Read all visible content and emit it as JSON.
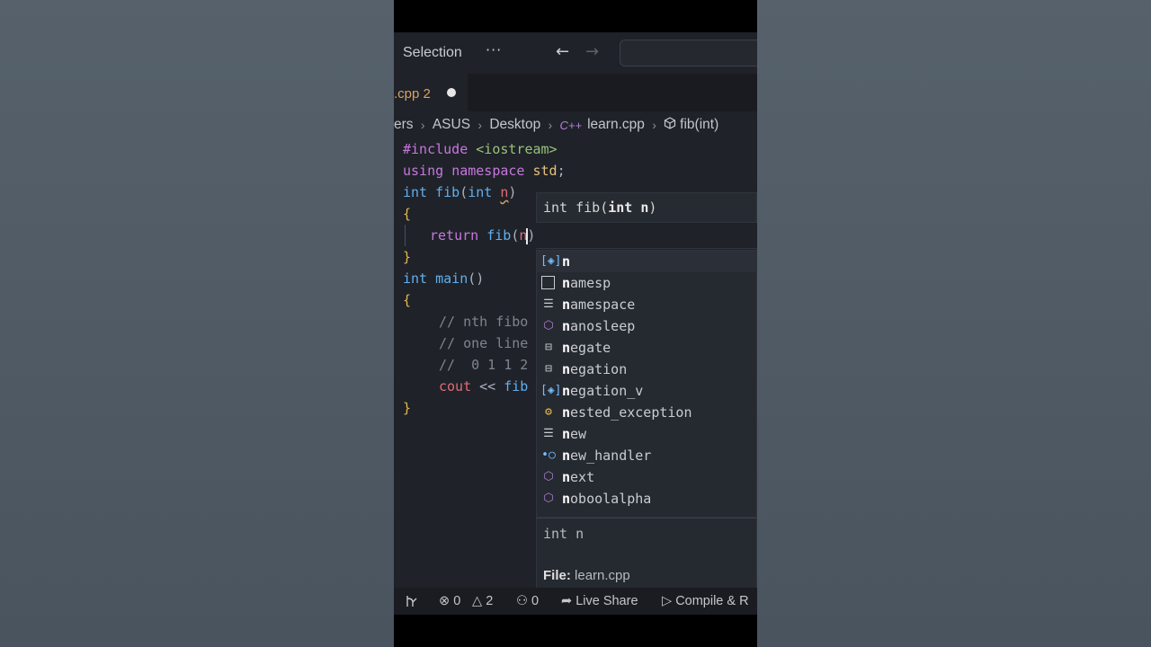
{
  "titlebar": {
    "menu_selection": "Selection",
    "menu_more": "···",
    "nav_back": "←",
    "nav_forward": "→"
  },
  "tab": {
    "label": ".cpp 2",
    "modified_dot": "●"
  },
  "breadcrumb": {
    "items": [
      "ers",
      "ASUS",
      "Desktop",
      "learn.cpp",
      "fib(int)"
    ],
    "separator": "›",
    "cpp_icon": "C++",
    "function_icon": "cube-icon"
  },
  "code": {
    "line1_directive": "#include",
    "line1_header": "<iostream>",
    "line2_kw1": "using",
    "line2_kw2": "namespace",
    "line2_ns": "std",
    "line2_semi": ";",
    "line3_type": "int",
    "line3_fn": "fib",
    "line3_open": "(",
    "line3_ptype": "int",
    "line3_param": "n",
    "line3_close": ")",
    "line4": "{",
    "line5_kw": "return",
    "line5_fn": "fib",
    "line5_open": "(",
    "line5_arg": "n",
    "line5_close": ")",
    "line6": "}",
    "line7_type": "int",
    "line7_fn": "main",
    "line7_parens": "()",
    "line8": "{",
    "line9": "// nth fibo",
    "line10": "// one line",
    "line11": "//  0 1 1 2",
    "line12_cout": "cout",
    "line12_op": "<<",
    "line12_fn": "fib",
    "line13": "}"
  },
  "signature_hint": {
    "type": "int",
    "name": "fib",
    "open": "(",
    "param": "int n",
    "close": ")"
  },
  "suggestions": [
    {
      "icon": "variable-icon",
      "match": "n",
      "rest": ""
    },
    {
      "icon": "namespace-icon",
      "match": "n",
      "rest": "amesp"
    },
    {
      "icon": "keyword-icon",
      "match": "n",
      "rest": "amespace"
    },
    {
      "icon": "method-icon",
      "match": "n",
      "rest": "anosleep"
    },
    {
      "icon": "struct-icon",
      "match": "n",
      "rest": "egate"
    },
    {
      "icon": "struct-icon",
      "match": "n",
      "rest": "egation"
    },
    {
      "icon": "variable-icon",
      "match": "n",
      "rest": "egation_v"
    },
    {
      "icon": "class-icon",
      "match": "n",
      "rest": "ested_exception"
    },
    {
      "icon": "keyword-icon",
      "match": "n",
      "rest": "ew"
    },
    {
      "icon": "interface-icon",
      "match": "n",
      "rest": "ew_handler"
    },
    {
      "icon": "method-icon",
      "match": "n",
      "rest": "ext"
    },
    {
      "icon": "method-icon",
      "match": "n",
      "rest": "oboolalpha"
    }
  ],
  "suggestion_detail": {
    "signature": "int n",
    "file_label": "File:",
    "file_name": "learn.cpp"
  },
  "statusbar": {
    "errors": "0",
    "warnings": "2",
    "ports": "0",
    "live_share": "Live Share",
    "compile": "Compile & R"
  },
  "colors": {
    "editor_bg": "#1f2229",
    "keyword": "#c678dd",
    "function": "#61afef",
    "string": "#98c379",
    "namespace": "#e5c07b",
    "tab_modified": "#d7a264"
  }
}
